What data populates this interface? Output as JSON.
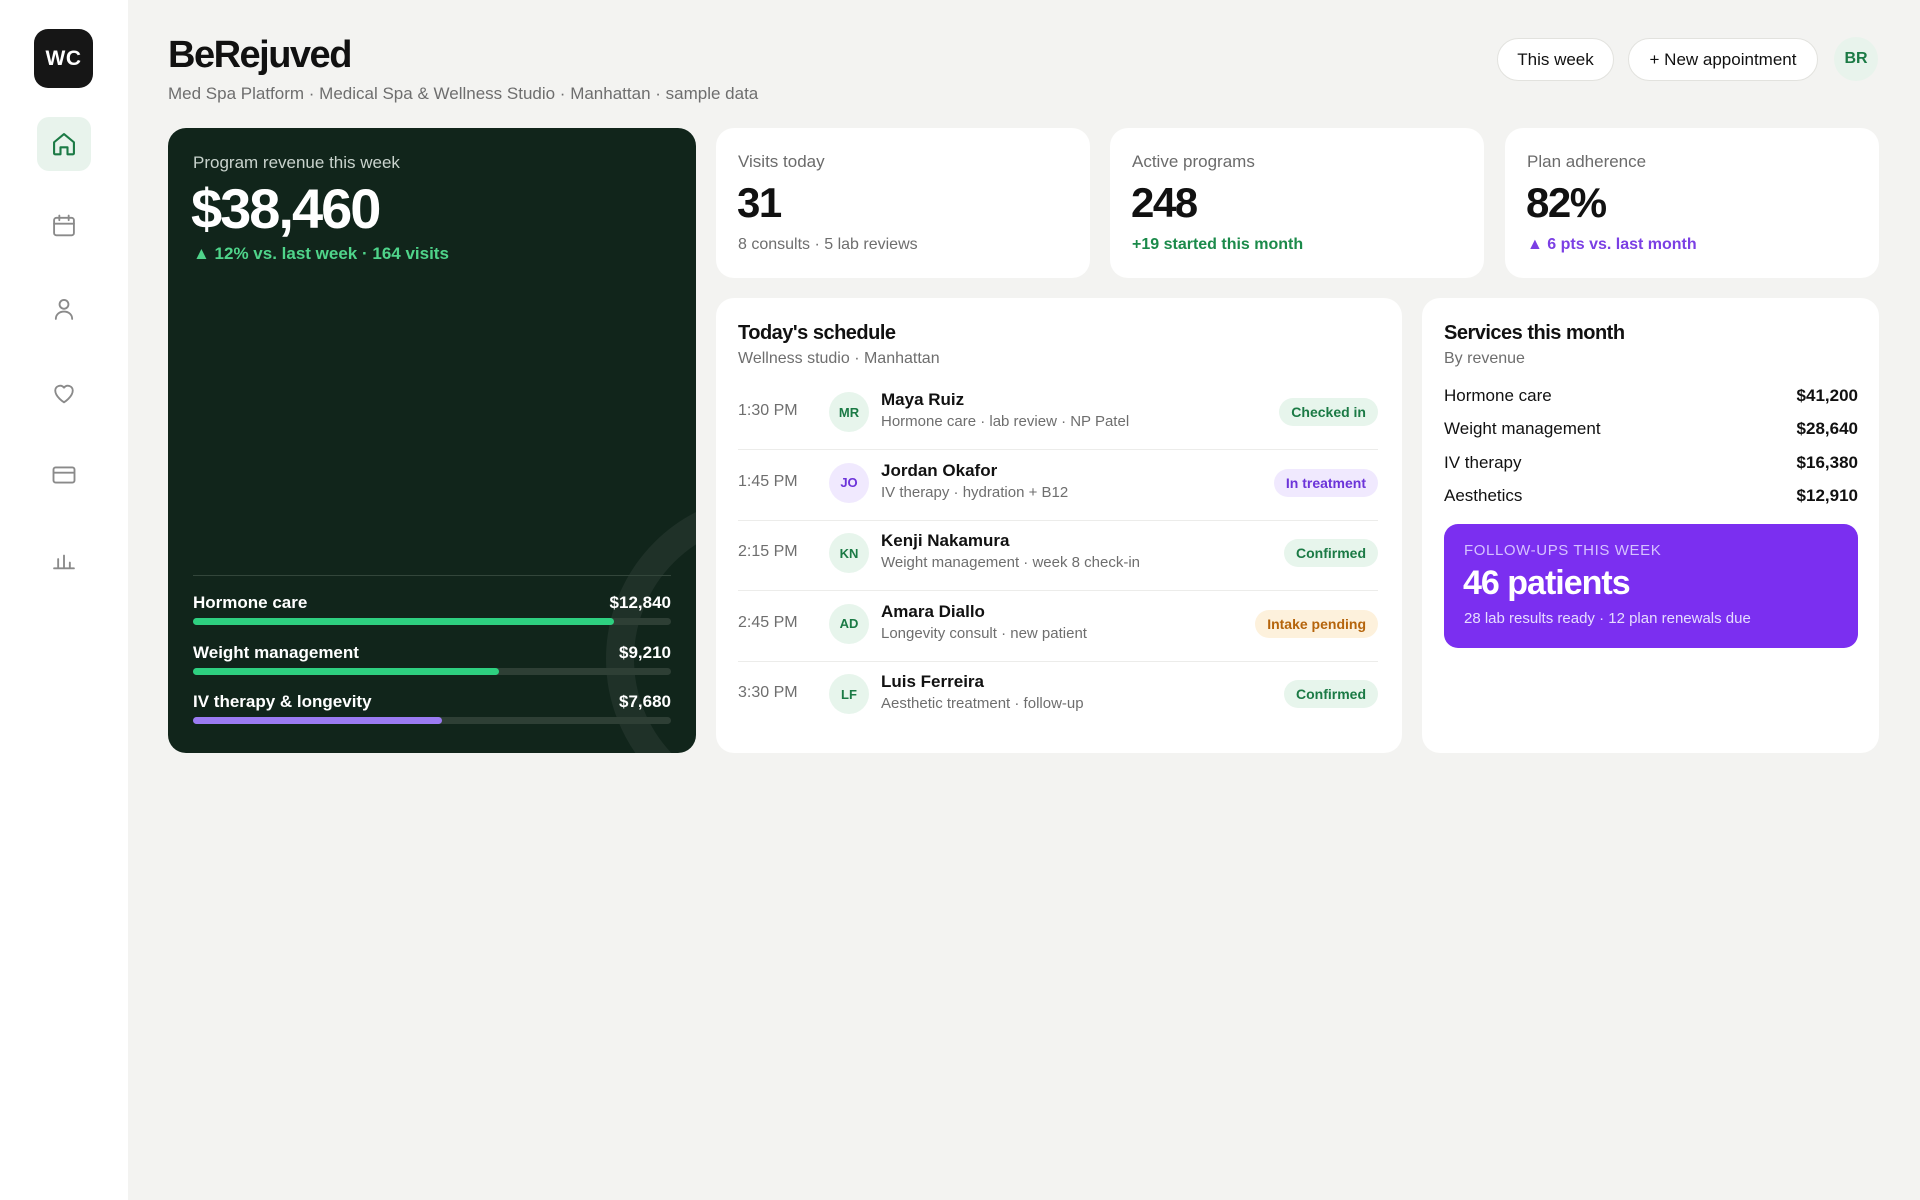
{
  "app": {
    "logo": "WC",
    "title": "BeRejuved",
    "subtitle": "Med Spa Platform · Medical Spa & Wellness Studio · Manhattan · sample data"
  },
  "header": {
    "week_button": "This week",
    "new_button": "+ New appointment",
    "avatar": "BR"
  },
  "sidebar": {
    "items": [
      {
        "icon": "home-icon",
        "active": true
      },
      {
        "icon": "calendar-icon",
        "active": false
      },
      {
        "icon": "user-icon",
        "active": false
      },
      {
        "icon": "heart-icon",
        "active": false
      },
      {
        "icon": "credit-card-icon",
        "active": false
      },
      {
        "icon": "bar-chart-icon",
        "active": false
      }
    ]
  },
  "revenue": {
    "label": "Program revenue this week",
    "value": "$38,460",
    "delta": "▲ 12% vs. last week · 164 visits",
    "rows": [
      {
        "label": "Hormone care",
        "amount": "$12,840",
        "fraction": 0.88,
        "color": "#2ed080"
      },
      {
        "label": "Weight management",
        "amount": "$9,210",
        "fraction": 0.64,
        "color": "#2ed080"
      },
      {
        "label": "IV therapy & longevity",
        "amount": "$7,680",
        "fraction": 0.52,
        "color": "#9b7bf2"
      }
    ]
  },
  "kpis": {
    "visits": {
      "label": "Visits today",
      "value": "31",
      "sub": "8 consults · 5 lab reviews"
    },
    "programs": {
      "label": "Active programs",
      "value": "248",
      "sub": "+19 started this month"
    },
    "adherence": {
      "label": "Plan adherence",
      "value": "82%",
      "sub": "▲ 6 pts vs. last month"
    }
  },
  "schedule": {
    "title": "Today's schedule",
    "subtitle": "Wellness studio · Manhattan",
    "rows": [
      {
        "time": "1:30 PM",
        "initials": "MR",
        "name": "Maya Ruiz",
        "detail": "Hormone care · lab review · NP Patel",
        "status": "Checked in",
        "tone": "green"
      },
      {
        "time": "1:45 PM",
        "initials": "JO",
        "name": "Jordan Okafor",
        "detail": "IV therapy · hydration + B12",
        "status": "In treatment",
        "tone": "purple"
      },
      {
        "time": "2:15 PM",
        "initials": "KN",
        "name": "Kenji Nakamura",
        "detail": "Weight management · week 8 check-in",
        "status": "Confirmed",
        "tone": "green"
      },
      {
        "time": "2:45 PM",
        "initials": "AD",
        "name": "Amara Diallo",
        "detail": "Longevity consult · new patient",
        "status": "Intake pending",
        "tone": "orange"
      },
      {
        "time": "3:30 PM",
        "initials": "LF",
        "name": "Luis Ferreira",
        "detail": "Aesthetic treatment · follow-up",
        "status": "Confirmed",
        "tone": "green"
      }
    ]
  },
  "services": {
    "title": "Services this month",
    "subtitle": "By revenue",
    "rows": [
      {
        "name": "Hormone care",
        "amount": "$41,200"
      },
      {
        "name": "Weight management",
        "amount": "$28,640"
      },
      {
        "name": "IV therapy",
        "amount": "$16,380"
      },
      {
        "name": "Aesthetics",
        "amount": "$12,910"
      }
    ]
  },
  "followups": {
    "label": "FOLLOW-UPS THIS WEEK",
    "value": "46 patients",
    "sub": "28 lab results ready · 12 plan renewals due"
  },
  "colors": {
    "accent_green": "#1b8a4a",
    "accent_purple": "#7b2ff0",
    "revenue_card_bg": "#11251b"
  }
}
